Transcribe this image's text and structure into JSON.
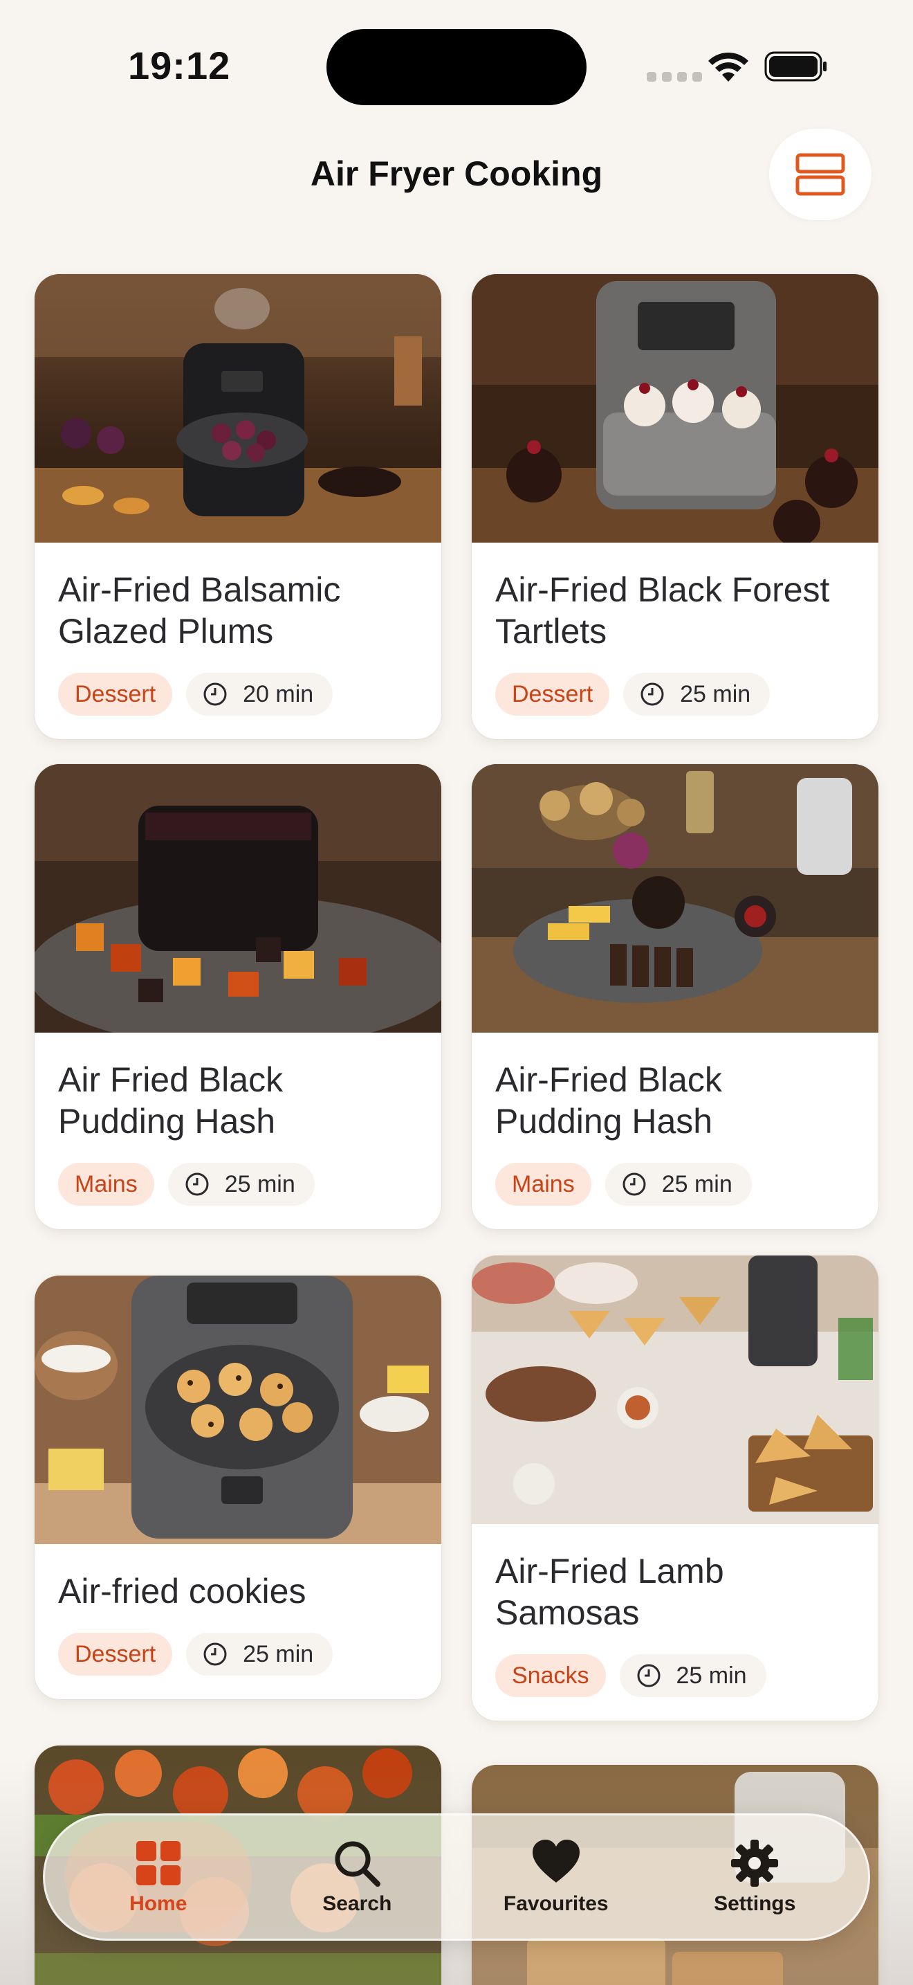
{
  "status_bar": {
    "time": "19:12"
  },
  "header": {
    "title": "Air Fryer Cooking"
  },
  "recipes": [
    {
      "title": "Air-Fried Balsamic Glazed Plums",
      "category": "Dessert",
      "time": "20 min"
    },
    {
      "title": "Air-Fried Black Forest Tartlets",
      "category": "Dessert",
      "time": "25 min"
    },
    {
      "title": "Air Fried Black Pudding Hash",
      "category": "Mains",
      "time": "25 min"
    },
    {
      "title": "Air-Fried Black Pudding Hash",
      "category": "Mains",
      "time": "25 min"
    },
    {
      "title": "Air-fried cookies",
      "category": "Dessert",
      "time": "25 min"
    },
    {
      "title": "Air-Fried Lamb Samosas",
      "category": "Snacks",
      "time": "25 min"
    }
  ],
  "tabbar": {
    "active": "Home",
    "items": [
      {
        "label": "Home",
        "icon": "grid-icon"
      },
      {
        "label": "Search",
        "icon": "search-icon"
      },
      {
        "label": "Favourites",
        "icon": "heart-icon"
      },
      {
        "label": "Settings",
        "icon": "gear-icon"
      }
    ]
  },
  "colors": {
    "accent": "#d8441a",
    "background": "#f8f5f1",
    "category_pill": "#fde6dc"
  }
}
